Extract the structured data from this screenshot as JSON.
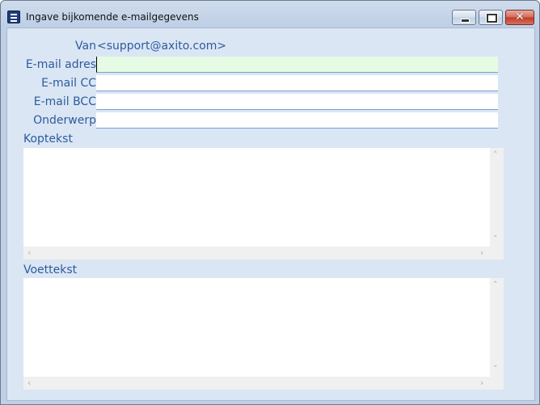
{
  "window": {
    "title": "Ingave bijkomende e-mailgegevens",
    "icon": "form-icon",
    "controls": {
      "minimize": "minimize-icon",
      "maximize": "maximize-icon",
      "close": "close-icon"
    }
  },
  "form": {
    "van": {
      "label": "Van",
      "value": "<support@axito.com>"
    },
    "email": {
      "label": "E-mail adres",
      "value": ""
    },
    "cc": {
      "label": "E-mail CC",
      "value": ""
    },
    "bcc": {
      "label": "E-mail BCC",
      "value": ""
    },
    "subject": {
      "label": "Onderwerp",
      "value": ""
    },
    "header": {
      "label": "Koptekst",
      "value": ""
    },
    "footer": {
      "label": "Voettekst",
      "value": ""
    }
  },
  "scroll_glyphs": {
    "up": "˄",
    "down": "˅",
    "left": "‹",
    "right": "›"
  },
  "colors": {
    "label": "#2c5b9e",
    "active_field": "#e6fbe4",
    "client_bg": "#dbe6f4"
  }
}
